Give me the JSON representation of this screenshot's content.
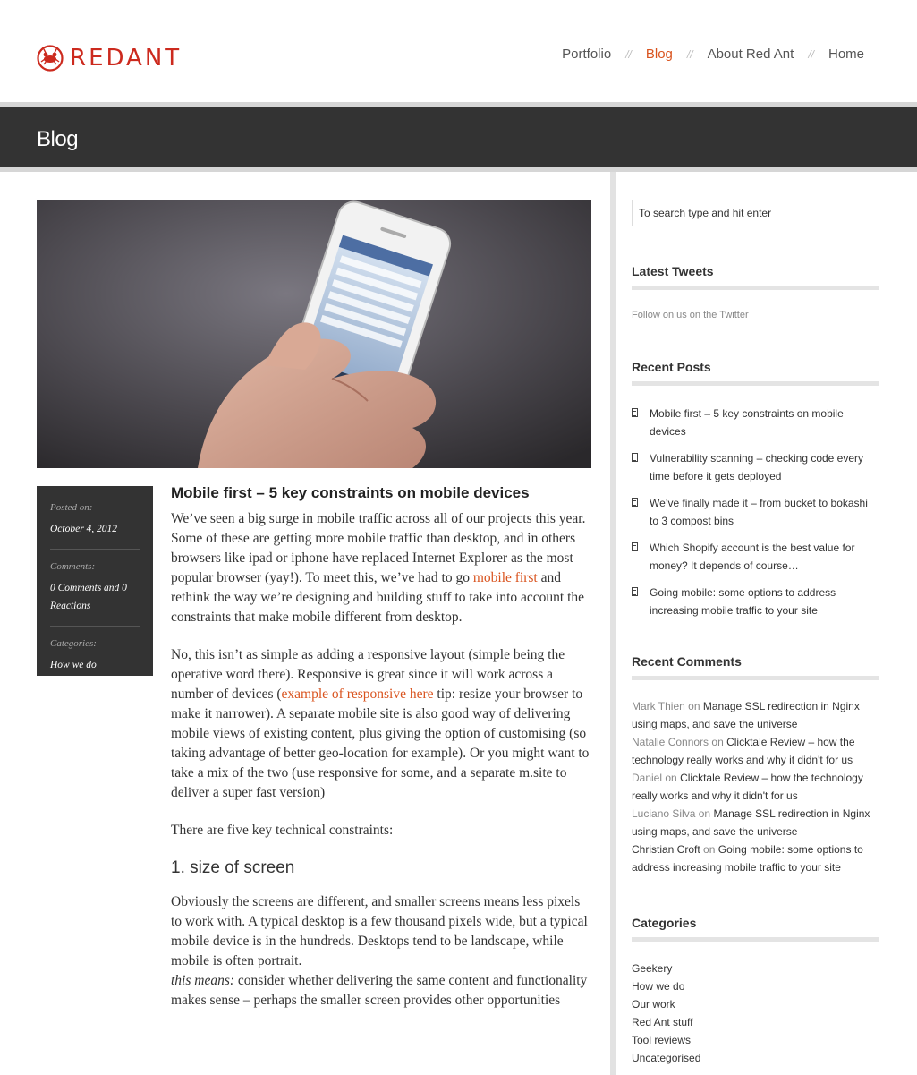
{
  "brand": {
    "name": "REDANT",
    "accent": "#cc2a1e"
  },
  "nav": {
    "items": [
      {
        "label": "Portfolio",
        "active": false
      },
      {
        "label": "Blog",
        "active": true
      },
      {
        "label": "About Red Ant",
        "active": false
      },
      {
        "label": "Home",
        "active": false
      }
    ],
    "separator": "//"
  },
  "page_title": "Blog",
  "meta": {
    "posted_label": "Posted on:",
    "posted_value": "October 4, 2012",
    "comments_label": "Comments:",
    "comments_value": "0 Comments and 0 Reactions",
    "categories_label": "Categories:",
    "categories_value": "How we do"
  },
  "article": {
    "title": "Mobile first – 5 key constraints on mobile devices",
    "p1_a": "We’ve seen a big surge in mobile traffic across all of our projects this year. Some of these are getting more mobile traffic than desktop, and in others browsers like ipad or iphone have replaced Internet Explorer as the most popular browser (yay!). To meet this, we’ve had to go ",
    "p1_link": "mobile first",
    "p1_b": " and rethink the way we’re designing and building stuff to take into account the constraints that make mobile different from desktop.",
    "p2_a": "No, this isn’t as simple as adding a responsive layout (simple being the operative word there). Responsive is great since it will work across a number of devices (",
    "p2_link": "example of responsive here",
    "p2_b": " tip: resize your browser to make it narrower). A separate mobile site is also good way of delivering mobile views of existing content, plus giving the option of customising (so taking advantage of better geo-location for example). Or you might want to take a mix of the two (use responsive for some, and a separate m.site to deliver a super fast version)",
    "p3": "There are five key technical constraints:",
    "h3": "1. size of screen",
    "p4": "Obviously the screens are different, and smaller screens means less pixels to work with. A typical desktop is a few thousand pixels wide, but a typical mobile device is in the hundreds. Desktops tend to be landscape, while mobile is often portrait.",
    "p4_em": "this means:",
    "p4_b": " consider whether delivering the same content and functionality makes sense – perhaps the smaller screen provides other opportunities"
  },
  "sidebar": {
    "search_placeholder": "To search type and hit enter",
    "tweets_title": "Latest Tweets",
    "follow_text": "Follow on us on the Twitter",
    "recent_posts_title": "Recent Posts",
    "recent_posts": [
      "Mobile first – 5 key constraints on mobile devices",
      "Vulnerability scanning – checking code every time before it gets deployed",
      "We’ve finally made it – from bucket to bokashi to 3 compost bins",
      "Which Shopify account is the best value for money? It depends of course…",
      "Going mobile: some options to address increasing mobile traffic to your site"
    ],
    "recent_comments_title": "Recent Comments",
    "recent_comments": [
      {
        "author": "Mark Thien",
        "on": "on",
        "post": "Manage SSL redirection in Nginx using maps, and save the universe"
      },
      {
        "author": "Natalie Connors",
        "on": "on",
        "post": "Clicktale Review – how the technology really works and why it didn't for us"
      },
      {
        "author": "Daniel",
        "on": "on",
        "post": "Clicktale Review – how the technology really works and why it didn't for us"
      },
      {
        "author": "Luciano Silva",
        "on": "on",
        "post": "Manage SSL redirection in Nginx using maps, and save the universe"
      },
      {
        "author": "Christian Croft",
        "on": "on",
        "post": "Going mobile: some options to address increasing mobile traffic to your site"
      }
    ],
    "categories_title": "Categories",
    "categories": [
      "Geekery",
      "How we do",
      "Our work",
      "Red Ant stuff",
      "Tool reviews",
      "Uncategorised"
    ]
  }
}
